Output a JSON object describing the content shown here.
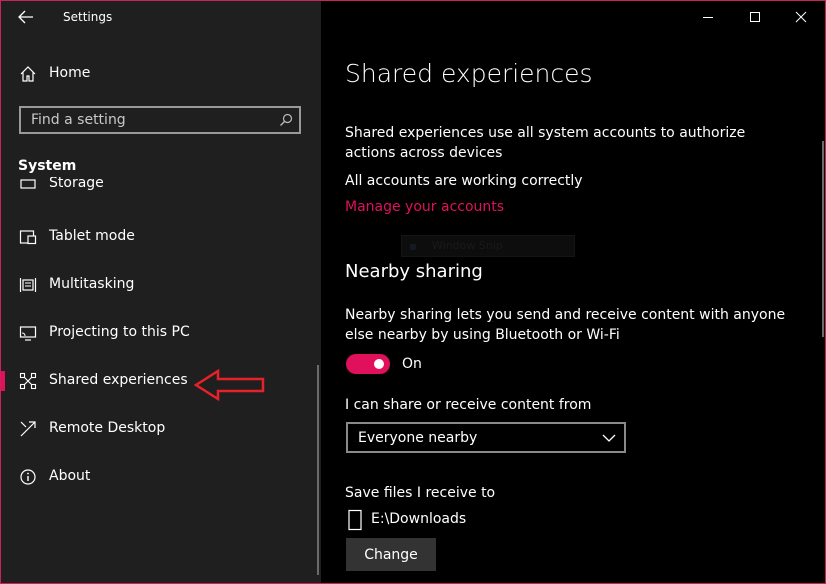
{
  "window": {
    "title": "Settings"
  },
  "sidebar": {
    "home_label": "Home",
    "search": {
      "placeholder": "Find a setting",
      "value": ""
    },
    "section_heading": "System",
    "items": [
      {
        "label": "Storage",
        "icon": "storage-icon",
        "selected": false
      },
      {
        "label": "Tablet mode",
        "icon": "tablet-mode-icon",
        "selected": false
      },
      {
        "label": "Multitasking",
        "icon": "multitasking-icon",
        "selected": false
      },
      {
        "label": "Projecting to this PC",
        "icon": "projecting-icon",
        "selected": false
      },
      {
        "label": "Shared experiences",
        "icon": "shared-experiences-icon",
        "selected": true
      },
      {
        "label": "Remote Desktop",
        "icon": "remote-desktop-icon",
        "selected": false
      },
      {
        "label": "About",
        "icon": "info-icon",
        "selected": false
      }
    ]
  },
  "content": {
    "page_title": "Shared experiences",
    "intro": "Shared experiences use all system accounts to authorize actions across devices",
    "account_status": "All accounts are working correctly",
    "manage_link": "Manage your accounts",
    "ghost_window_label": "Window Snip",
    "nearby": {
      "title": "Nearby sharing",
      "description": "Nearby sharing lets you send and receive content with anyone else nearby by using Bluetooth or Wi-Fi",
      "toggle_state": "On",
      "share_from_label": "I can share or receive content from",
      "share_from_value": "Everyone nearby",
      "save_label": "Save files I receive to",
      "save_path": "E:\\Downloads",
      "change_label": "Change"
    }
  },
  "colors": {
    "accent": "#e0105d",
    "sidebar_bg": "#1f1f1f",
    "content_bg": "#000000",
    "annotation": "#e8202a"
  }
}
